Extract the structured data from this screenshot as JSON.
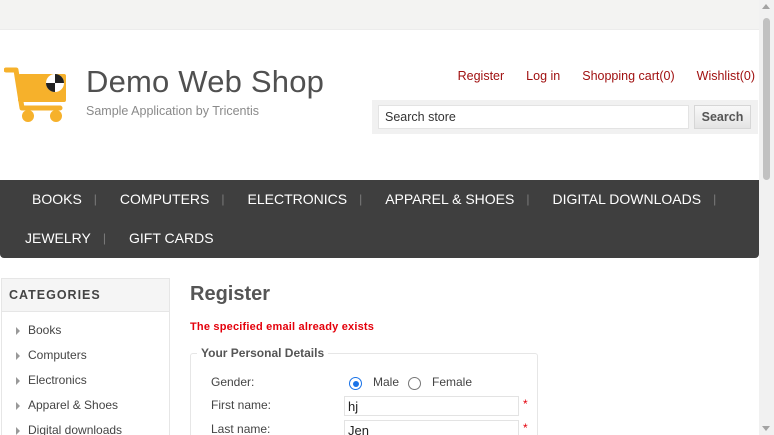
{
  "header": {
    "title": "Demo Web Shop",
    "subtitle": "Sample Application by Tricentis",
    "links": [
      "Register",
      "Log in",
      "Shopping cart(0)",
      "Wishlist(0)"
    ],
    "search_value": "Search store",
    "search_button": "Search"
  },
  "top_menu": {
    "row1": [
      "BOOKS",
      "COMPUTERS",
      "ELECTRONICS",
      "APPAREL & SHOES",
      "DIGITAL DOWNLOADS"
    ],
    "row2": [
      "JEWELRY",
      "GIFT CARDS"
    ]
  },
  "categories": {
    "title": "CATEGORIES",
    "items": [
      "Books",
      "Computers",
      "Electronics",
      "Apparel & Shoes",
      "Digital downloads"
    ]
  },
  "register": {
    "title": "Register",
    "error": "The specified email already exists",
    "section_title": "Your Personal Details",
    "gender_label": "Gender:",
    "male_label": "Male",
    "female_label": "Female",
    "gender_selected": "Male",
    "first_name_label": "First name:",
    "first_name_value": "hj",
    "last_name_label": "Last name:",
    "last_name_value": "Jen",
    "required_mark": "*"
  },
  "colors": {
    "link_red": "#a01010",
    "menu_bg": "#3f3f3f",
    "error_red": "#e4000b",
    "logo_yellow": "#f6b12b"
  },
  "icons": [
    "shopping-cart-logo-icon",
    "chevron-right-icon",
    "scroll-up-icon",
    "scroll-down-icon"
  ]
}
